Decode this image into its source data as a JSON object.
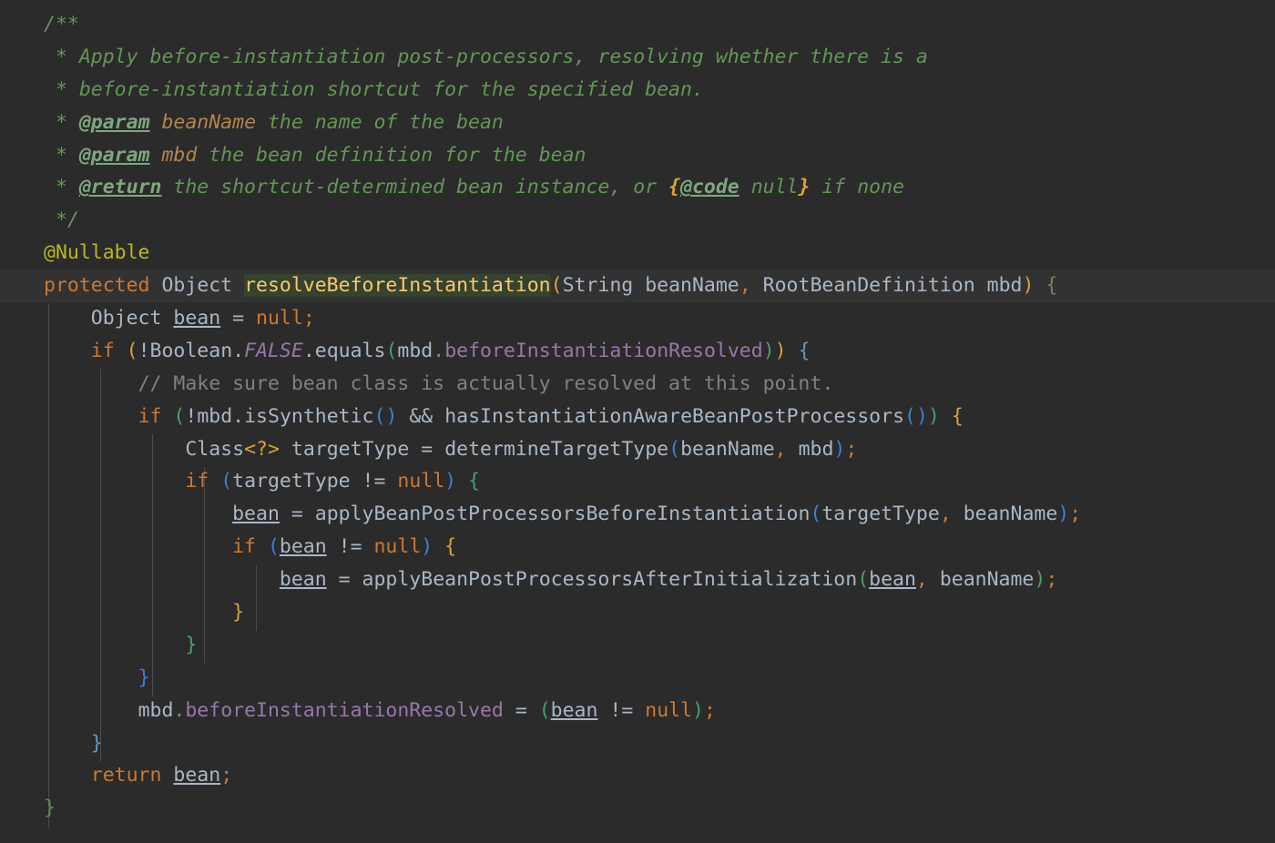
{
  "editor": {
    "language": "Java",
    "theme": "Darcula",
    "background_color": "#2b2b2b",
    "caret_line_color": "#323232",
    "identifier_highlight_color": "#35432f",
    "font_size_px": 21.5,
    "line_height_px": 35.9
  },
  "colors": {
    "javadoc": "#629755",
    "javadoc_tag": "#7da87d",
    "javadoc_param_name": "#b2844b",
    "javadoc_brace": "#d9a336",
    "line_comment": "#808080",
    "annotation": "#bbb529",
    "keyword": "#cc7832",
    "identifier": "#a9b7c6",
    "method_name": "#ffc66d",
    "field": "#9876aa",
    "static_constant": "#9876aa",
    "bracket_level_1": "#d9a336",
    "bracket_level_2": "#4a9f6e",
    "bracket_level_3": "#3f7fd4",
    "indent_guide": "#4b4b4b",
    "caret": "#ffffff"
  },
  "code": {
    "line_01": {
      "doc_open": "/**"
    },
    "line_02": {
      "star": " * ",
      "text": "Apply before-instantiation post-processors, resolving whether there is a"
    },
    "line_03": {
      "star": " * ",
      "text": "before-instantiation shortcut for the specified bean."
    },
    "line_04": {
      "star": " * ",
      "tag": "@param",
      "param": " beanName",
      "text": " the name of the bean"
    },
    "line_05": {
      "star": " * ",
      "tag": "@param",
      "param": " mbd",
      "text": " the bean definition for the bean"
    },
    "line_06": {
      "star": " * ",
      "tag": "@return",
      "text_a": " the shortcut-determined bean instance, or ",
      "brace_open": "{",
      "code_tag": "@code",
      "text_b": " null",
      "brace_close": "}",
      "text_c": " if none"
    },
    "line_07": {
      "doc_close": " */"
    },
    "line_08": {
      "annotation": "@Nullable"
    },
    "line_09": {
      "kw_protected": "protected",
      "type_object": "Object",
      "method_name": "resolveBeforeInstantiation",
      "paren_open": "(",
      "type_string": "String",
      "param_beanname": "beanName",
      "comma": ",",
      "type_rootbeandef": "RootBeanDefinition",
      "param_mbd": "mbd",
      "paren_close": ")",
      "brace_open": "{"
    },
    "line_10": {
      "type_object": "Object",
      "var_bean": "bean",
      "equals": "=",
      "null": "null",
      "semi": ";"
    },
    "line_11": {
      "kw_if": "if",
      "paren_open": "(",
      "bang": "!",
      "type_boolean": "Boolean",
      "dot1": ".",
      "const_false": "FALSE",
      "dot2": ".",
      "method_equals": "equals",
      "paren_inner_open": "(",
      "ident_mbd": "mbd",
      "dot3": ".",
      "field": "beforeInstantiationResolved",
      "paren_inner_close": ")",
      "paren_close": ")",
      "brace_open": "{"
    },
    "line_12": {
      "comment": "// Make sure bean class is actually resolved at this point."
    },
    "line_13": {
      "kw_if": "if",
      "paren_open": "(",
      "bang": "!",
      "ident_mbd": "mbd",
      "dot": ".",
      "method_issynthetic": "isSynthetic",
      "empty_parens": "()",
      "and": "&&",
      "method_has": "hasInstantiationAwareBeanPostProcessors",
      "empty_parens2": "()",
      "paren_close": ")",
      "brace_open": "{"
    },
    "line_14": {
      "type_class": "Class",
      "generic": "<?>",
      "var_targettype": "targetType",
      "equals": "=",
      "method_determine": "determineTargetType",
      "paren_open": "(",
      "arg_beanname": "beanName",
      "comma": ",",
      "arg_mbd": "mbd",
      "paren_close": ")",
      "semi": ";"
    },
    "line_15": {
      "kw_if": "if",
      "paren_open": "(",
      "var_targettype": "targetType",
      "neq": "!=",
      "null": "null",
      "paren_close": ")",
      "brace_open": "{"
    },
    "line_16": {
      "var_bean": "bean",
      "equals": "=",
      "method_apply": "applyBeanPostProcessorsBeforeInstantiation",
      "paren_open": "(",
      "arg_targettype": "targetType",
      "comma": ",",
      "arg_beanname": "beanName",
      "paren_close": ")",
      "semi": ";"
    },
    "line_17": {
      "kw_if": "if",
      "paren_open": "(",
      "var_bean": "bean",
      "neq": "!=",
      "null": "null",
      "paren_close": ")",
      "brace_open": "{"
    },
    "line_18": {
      "var_bean": "bean",
      "equals": "=",
      "method_apply": "applyBeanPostProcessorsAfterInitialization",
      "paren_open": "(",
      "arg_bean": "bean",
      "comma": ",",
      "arg_beanname": "beanName",
      "paren_close": ")",
      "semi": ";"
    },
    "line_19": {
      "brace_close": "}"
    },
    "line_20": {
      "brace_close": "}"
    },
    "line_21": {
      "brace_close": "}"
    },
    "line_22": {
      "ident_mbd": "mbd",
      "dot": ".",
      "field": "beforeInstantiationResolved",
      "equals": "=",
      "paren_open": "(",
      "var_bean": "bean",
      "neq": "!=",
      "null": "null",
      "paren_close": ")",
      "semi": ";"
    },
    "line_23": {
      "brace_close": "}"
    },
    "line_24": {
      "kw_return": "return",
      "var_bean": "bean",
      "semi": ";"
    },
    "line_25": {
      "brace_close": "}"
    }
  }
}
